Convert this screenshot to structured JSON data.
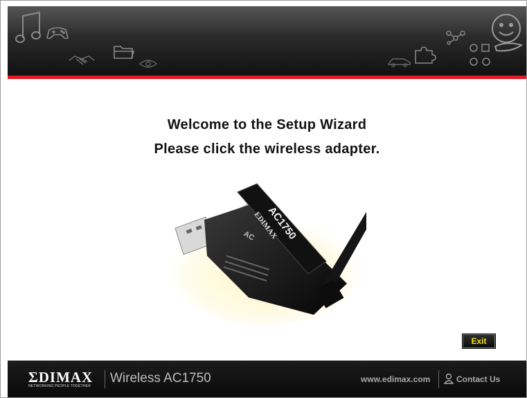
{
  "header": {
    "icons": [
      "music-note-icon",
      "gamepad-icon",
      "handshake-icon",
      "folder-icon",
      "eye-icon",
      "car-icon",
      "puzzle-icon",
      "molecule-icon",
      "network-icon",
      "smiley-face-icon"
    ]
  },
  "main": {
    "welcome_line1": "Welcome to the Setup Wizard",
    "welcome_line2": "Please click the wireless adapter.",
    "adapter": {
      "model_label": "AC1750",
      "brand_label": "EDIMAX",
      "badge_label": "AC"
    },
    "exit_label": "Exit"
  },
  "footer": {
    "logo_text": "ΣDIMAX",
    "logo_tagline": "NETWORKING PEOPLE TOGETHER",
    "product_name": "Wireless AC1750",
    "website": "www.edimax.com",
    "contact_label": "Contact Us"
  },
  "colors": {
    "accent_red": "#e31b23",
    "exit_text": "#f1e21a",
    "header_dark": "#1a1a1a"
  }
}
